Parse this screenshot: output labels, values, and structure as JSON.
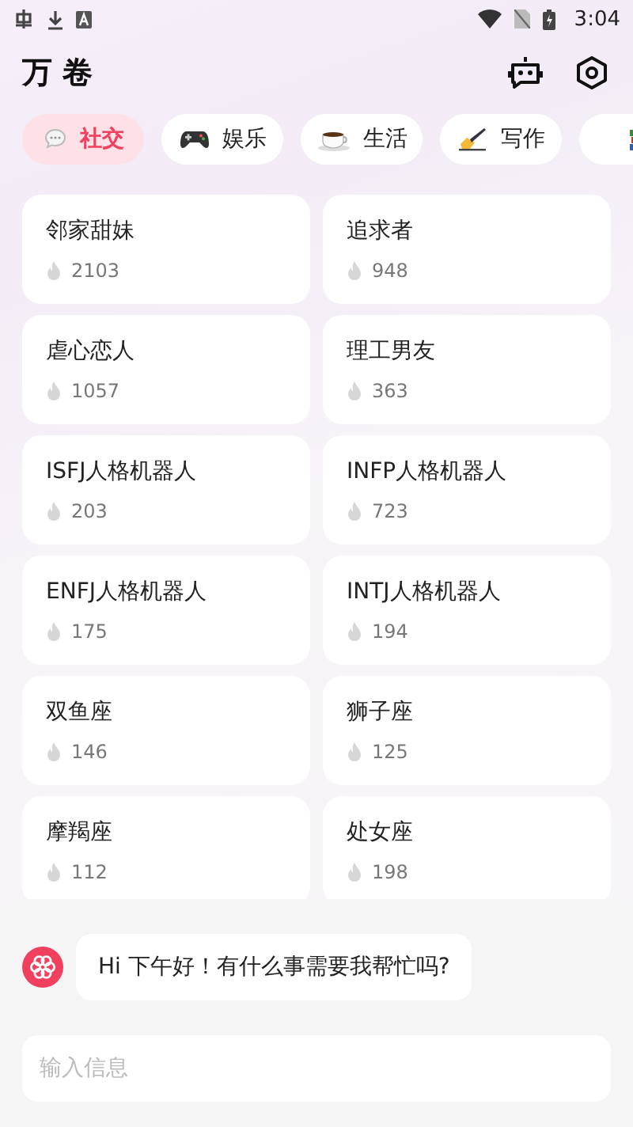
{
  "status_bar": {
    "time": "3:04"
  },
  "header": {
    "title": "万 卷"
  },
  "tabs": [
    {
      "label": "社交",
      "kind": "chat",
      "selected": true
    },
    {
      "label": "娱乐",
      "kind": "gamepad",
      "selected": false
    },
    {
      "label": "生活",
      "kind": "coffee",
      "selected": false
    },
    {
      "label": "写作",
      "kind": "pen",
      "selected": false
    },
    {
      "kind": "books",
      "selected": false
    }
  ],
  "cards": [
    {
      "name": "邻家甜妹",
      "count": "2103"
    },
    {
      "name": "追求者",
      "count": "948"
    },
    {
      "name": "虐心恋人",
      "count": "1057"
    },
    {
      "name": "理工男友",
      "count": "363"
    },
    {
      "name": "ISFJ人格机器人",
      "count": "203"
    },
    {
      "name": "INFP人格机器人",
      "count": "723"
    },
    {
      "name": "ENFJ人格机器人",
      "count": "175"
    },
    {
      "name": "INTJ人格机器人",
      "count": "194"
    },
    {
      "name": "双鱼座",
      "count": "146"
    },
    {
      "name": "狮子座",
      "count": "125"
    },
    {
      "name": "摩羯座",
      "count": "112"
    },
    {
      "name": "处女座",
      "count": "198"
    }
  ],
  "chat": {
    "message": "Hi 下午好！有什么事需要我帮忙吗?"
  },
  "input": {
    "placeholder": "输入信息"
  }
}
